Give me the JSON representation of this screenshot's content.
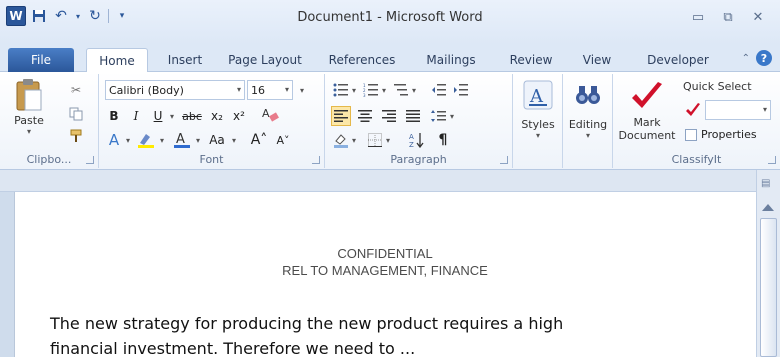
{
  "window": {
    "title": "Document1 - Microsoft Word",
    "logo": "W"
  },
  "tabs": [
    "File",
    "Home",
    "Insert",
    "Page Layout",
    "References",
    "Mailings",
    "Review",
    "View",
    "Developer"
  ],
  "ribbon": {
    "clipboard": {
      "label": "Clipbo...",
      "paste": "Paste"
    },
    "font": {
      "label": "Font",
      "family": "Calibri (Body)",
      "size": "16"
    },
    "paragraph": {
      "label": "Paragraph"
    },
    "styles": {
      "label": "Styles"
    },
    "editing": {
      "label": "Editing"
    },
    "classifyit": {
      "label": "ClassifyIt",
      "mark_line1": "Mark",
      "mark_line2": "Document",
      "quick_select": "Quick Select",
      "properties": "Properties"
    }
  },
  "document": {
    "header_line1": "CONFIDENTIAL",
    "header_line2": "REL TO MANAGEMENT, FINANCE",
    "body_line1": "The new strategy for producing the new product requires a high",
    "body_line2": "financial investment. Therefore we need to ..."
  },
  "colors": {
    "file_tab": "#2b579a",
    "accent": "#3a78c9",
    "mark_red": "#d0112b"
  }
}
